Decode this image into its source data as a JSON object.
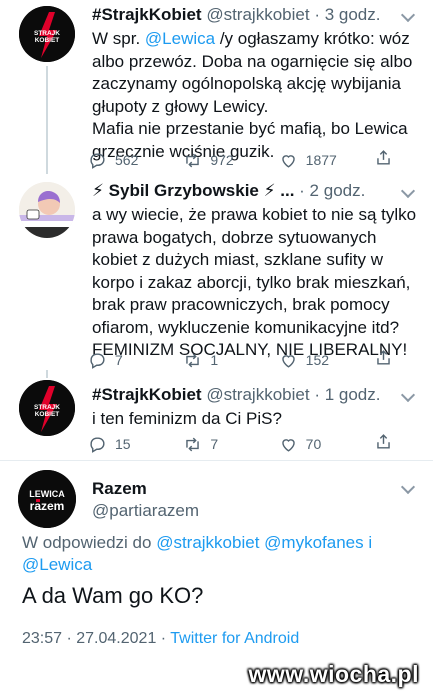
{
  "tweets": [
    {
      "name": "#StrajkKobiet",
      "handle": "@strajkkobiet",
      "time": "· 3 godz.",
      "avatar_text": "STRAJK KOBIET",
      "text_1_pre": "W spr. ",
      "text_1_mention": "@Lewica",
      "text_1_post": " /y ogłaszamy krótko: wóz albo przewóz. Doba na ogarnięcie się albo zaczynamy ogólnopolską akcję wybijania głupoty z głowy Lewicy.",
      "text_2": "Mafia nie przestanie być mafią, bo Lewica grzecznie wciśnie guzik.",
      "replies": "562",
      "retweets": "972",
      "likes": "1877"
    },
    {
      "name": "⚡ Sybil Grzybowskie ⚡ ...",
      "handle": "",
      "time": "· 2 godz.",
      "text": "a wy wiecie, że prawa kobiet to nie są tylko prawa bogatych, dobrze sytuowanych kobiet z dużych miast, szklane sufity w korpo i zakaz aborcji, tylko brak mieszkań, brak praw pracowniczych, brak pomocy ofiarom, wykluczenie komunikacyjne itd? FEMINIZM SOCJALNY, NIE LIBERALNY!",
      "replies": "7",
      "retweets": "1",
      "likes": "152"
    },
    {
      "name": "#StrajkKobiet",
      "handle": "@strajkkobiet",
      "time": "· 1 godz.",
      "avatar_text": "STRAJK KOBIET",
      "text": "i ten feminizm da Ci PiS?",
      "replies": "15",
      "retweets": "7",
      "likes": "70"
    }
  ],
  "main": {
    "name": "Razem",
    "handle": "@partiarazem",
    "avatar_text_1": "LEWICA",
    "avatar_text_2": "razem",
    "reply_prefix": "W odpowiedzi do ",
    "reply_mentions": "@strajkkobiet @mykofanes i",
    "reply_mention_2": "@Lewica",
    "text": "A da Wam go KO?",
    "timestamp": "23:57 · 27.04.2021 · ",
    "source": "Twitter for Android"
  },
  "watermark": "www.wiocha.pl",
  "colors": {
    "link": "#1d9bf0",
    "muted": "#536471",
    "strajk_red": "#e0002a"
  }
}
